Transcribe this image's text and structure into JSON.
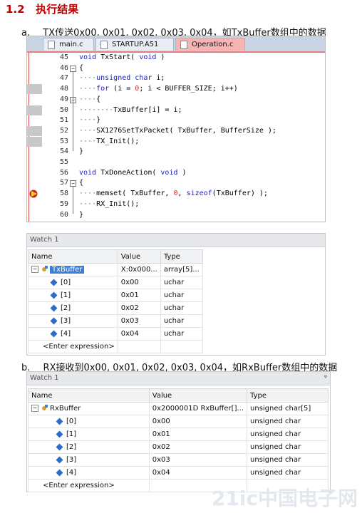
{
  "heading": {
    "number": "1.2",
    "title": "执行结果"
  },
  "caption_a": {
    "label": "a.",
    "text": "TX传送0x00, 0x01, 0x02, 0x03, 0x04，如TxBuffer数组中的数据"
  },
  "caption_b": {
    "label": "b.",
    "text": "RX接收到0x00, 0x01, 0x02, 0x03, 0x04，如RxBuffer数组中的数据"
  },
  "editor": {
    "tabs": [
      {
        "label": "main.c"
      },
      {
        "label": "STARTUP.A51"
      },
      {
        "label": "Operation.c"
      }
    ],
    "lines": [
      {
        "n": "45",
        "text": "void TxStart( void )"
      },
      {
        "n": "46",
        "text": "{"
      },
      {
        "n": "47",
        "text": "    unsigned char i;"
      },
      {
        "n": "48",
        "text": "    for (i = 0; i < BUFFER_SIZE; i++)"
      },
      {
        "n": "49",
        "text": "    {"
      },
      {
        "n": "50",
        "text": "        TxBuffer[i] = i;"
      },
      {
        "n": "51",
        "text": "    }"
      },
      {
        "n": "52",
        "text": "    SX1276SetTxPacket( TxBuffer, BufferSize );"
      },
      {
        "n": "53",
        "text": "    TX_Init();"
      },
      {
        "n": "54",
        "text": "}"
      },
      {
        "n": "55",
        "text": ""
      },
      {
        "n": "56",
        "text": "void TxDoneAction( void )"
      },
      {
        "n": "57",
        "text": "{"
      },
      {
        "n": "58",
        "text": "    memset( TxBuffer, 0, sizeof(TxBuffer) );"
      },
      {
        "n": "59",
        "text": "    RX_Init();"
      },
      {
        "n": "60",
        "text": "}"
      }
    ]
  },
  "watch1": {
    "title": "Watch 1",
    "headers": {
      "name": "Name",
      "value": "Value",
      "type": "Type"
    },
    "root": {
      "name": "TxBuffer",
      "value": "X:0x000...",
      "type": "array[5]..."
    },
    "items": [
      {
        "name": "[0]",
        "value": "0x00",
        "type": "uchar"
      },
      {
        "name": "[1]",
        "value": "0x01",
        "type": "uchar"
      },
      {
        "name": "[2]",
        "value": "0x02",
        "type": "uchar"
      },
      {
        "name": "[3]",
        "value": "0x03",
        "type": "uchar"
      },
      {
        "name": "[4]",
        "value": "0x04",
        "type": "uchar"
      }
    ],
    "enter": "<Enter expression>"
  },
  "watch2": {
    "title": "Watch 1",
    "headers": {
      "name": "Name",
      "value": "Value",
      "type": "Type"
    },
    "root": {
      "name": "RxBuffer",
      "value": "0x2000001D RxBuffer[]...",
      "type": "unsigned char[5]"
    },
    "items": [
      {
        "name": "[0]",
        "value": "0x00",
        "type": "unsigned char"
      },
      {
        "name": "[1]",
        "value": "0x01",
        "type": "unsigned char"
      },
      {
        "name": "[2]",
        "value": "0x02",
        "type": "unsigned char"
      },
      {
        "name": "[3]",
        "value": "0x03",
        "type": "unsigned char"
      },
      {
        "name": "[4]",
        "value": "0x04",
        "type": "unsigned char"
      }
    ],
    "enter": "<Enter expression>",
    "pin": "ᵠ"
  },
  "watermark": "21ic中国电子网"
}
